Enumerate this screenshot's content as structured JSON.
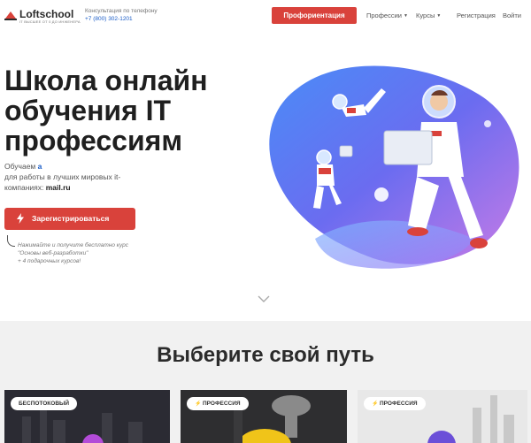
{
  "header": {
    "logo_name": "Loftschool",
    "logo_tagline": "IT ВЫСШЕЕ ОТ 0 ДО ИНЖЕНЕРА",
    "consult_label": "Консультация по телефону",
    "phone": "+7 (800) 302-1201",
    "cta_label": "Профориентация",
    "nav": {
      "professions": "Профессии",
      "courses": "Курсы",
      "register": "Регистрация",
      "login": "Войти"
    }
  },
  "hero": {
    "title": "Школа онлайн обучения IT профессиям",
    "sub_prefix": "Обучаем",
    "sub_accent": "а",
    "sub_middle": "для работы в лучших мировых it-компаниях:",
    "sub_company": "mail.ru",
    "register_label": "Зарегистрироваться",
    "note_line1": "Нажимайте и получите бесплатно курс",
    "note_line2": "\"Основы веб-разработки\"",
    "note_line3": "+ 4 подарочных курсов!"
  },
  "paths": {
    "title": "Выберите свой путь",
    "cards": [
      {
        "badge": "БЕСПОТОКОВЫЙ",
        "has_icon": false
      },
      {
        "badge": "ПРОФЕССИЯ",
        "has_icon": true
      },
      {
        "badge": "ПРОФЕССИЯ",
        "has_icon": true
      }
    ]
  },
  "colors": {
    "accent": "#d9423b",
    "link": "#1a5cc7",
    "illustration_blue": "#5b6cf0",
    "illustration_purple": "#c77be6"
  },
  "icons": [
    "logo-icon",
    "bolt-icon",
    "chevron-down-icon",
    "caret-down-icon"
  ]
}
